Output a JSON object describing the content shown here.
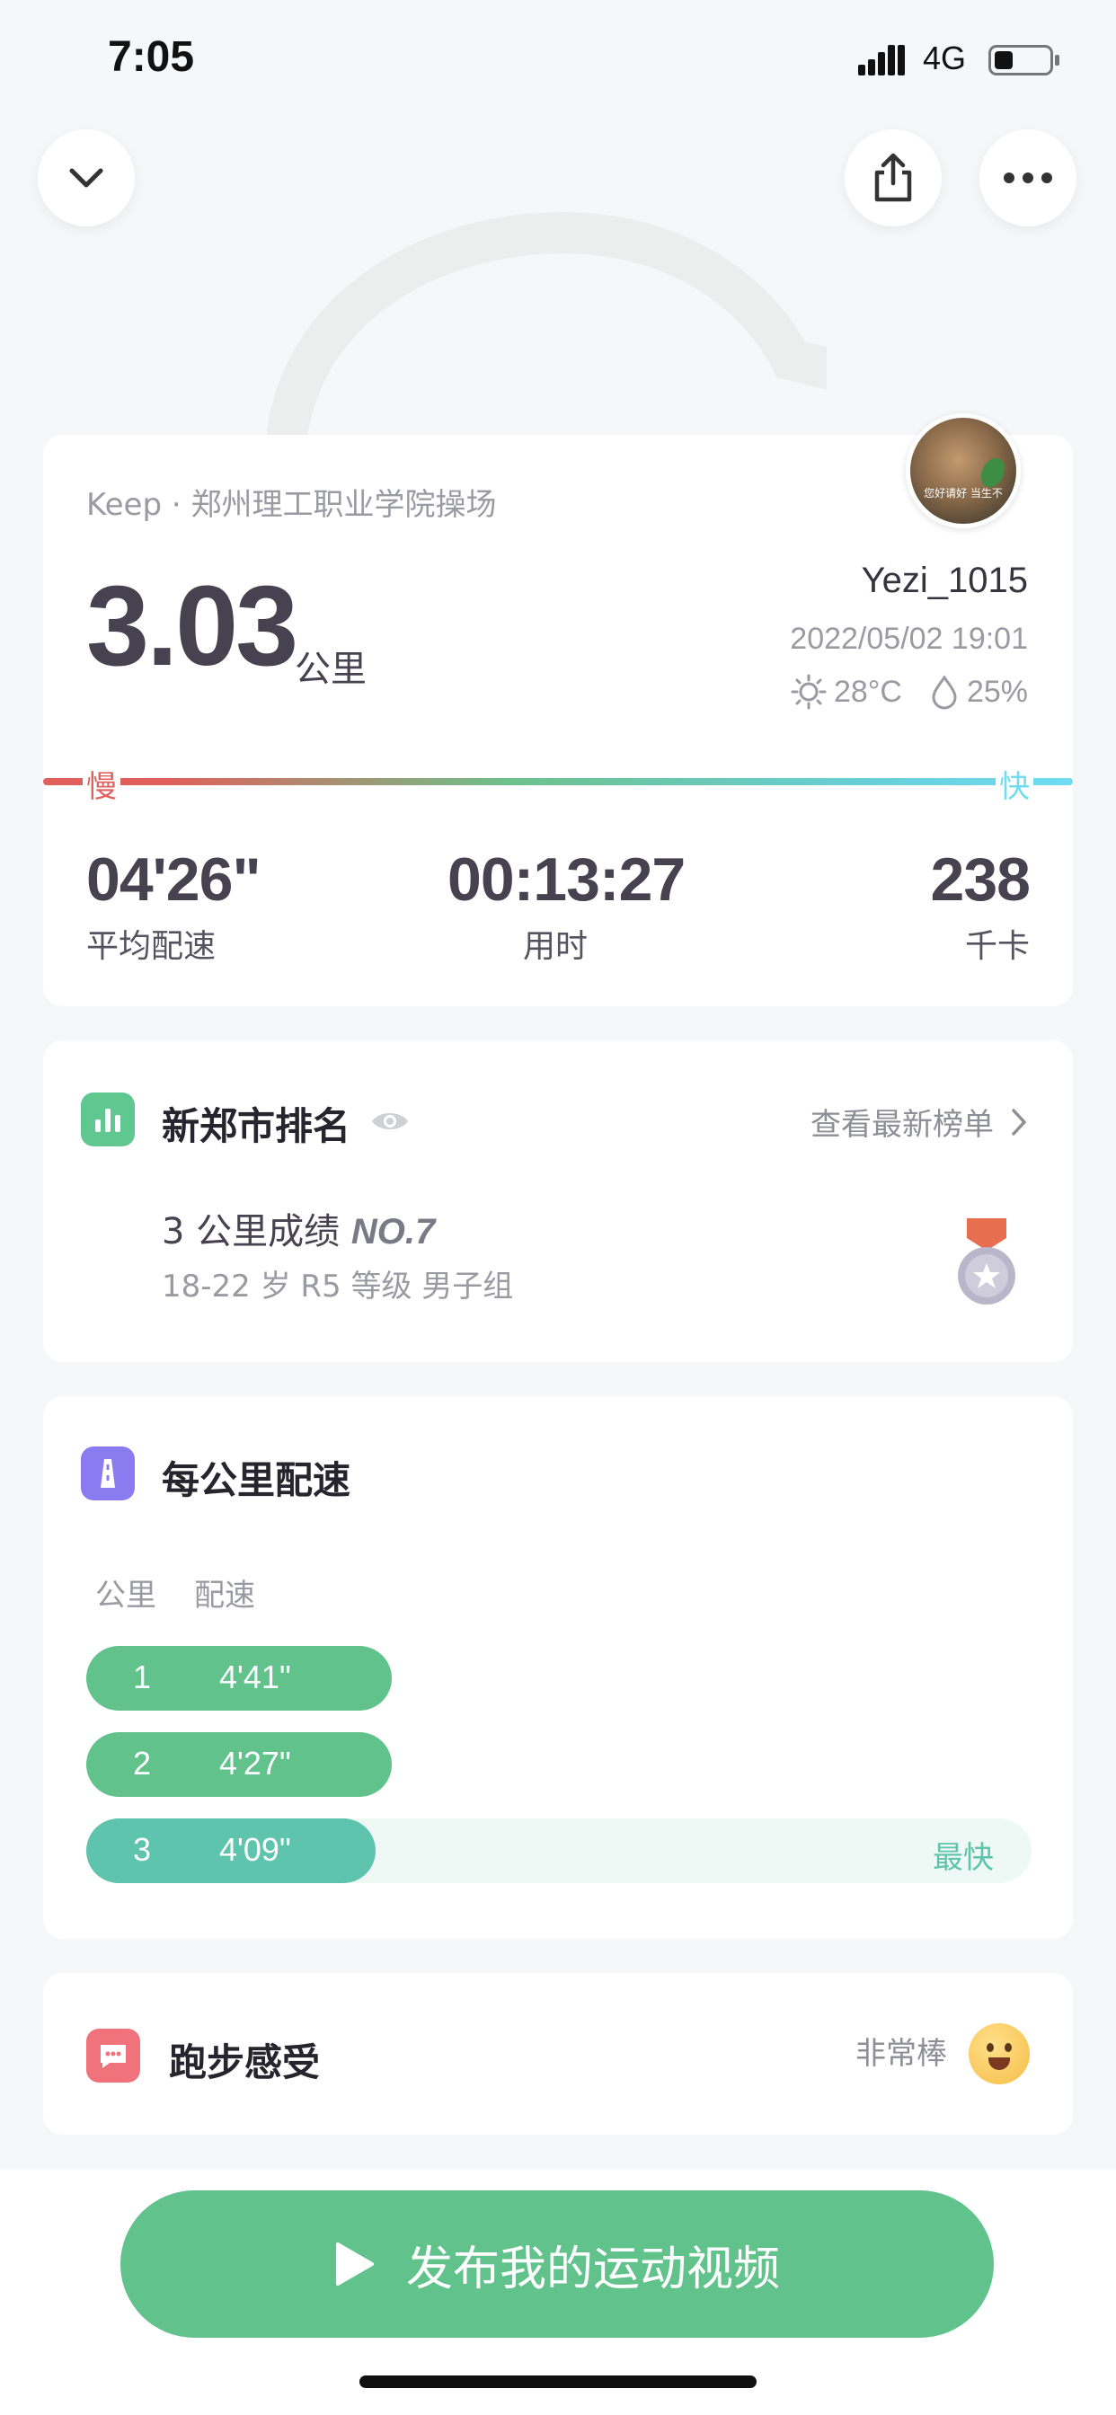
{
  "status_bar": {
    "time": "7:05",
    "network": "4G"
  },
  "summary": {
    "location": "Keep · 郑州理工职业学院操场",
    "distance": "3.03",
    "distance_unit": "公里",
    "username": "Yezi_1015",
    "datetime": "2022/05/02 19:01",
    "temperature": "28°C",
    "humidity": "25%",
    "avatar_caption": "您好请好 当生不",
    "slow_label": "慢",
    "fast_label": "快",
    "stats": [
      {
        "value": "04'26\"",
        "label": "平均配速"
      },
      {
        "value": "00:13:27",
        "label": "用时"
      },
      {
        "value": "238",
        "label": "千卡"
      }
    ]
  },
  "ranking": {
    "title": "新郑市排名",
    "link": "查看最新榜单",
    "record_prefix": "3 公里成绩",
    "record_no": "NO.7",
    "group": "18-22 岁 R5 等级 男子组"
  },
  "pace": {
    "title": "每公里配速",
    "col_km": "公里",
    "col_pace": "配速",
    "rows": [
      {
        "km": "1",
        "pace": "4'41\"",
        "fastest": false
      },
      {
        "km": "2",
        "pace": "4'27\"",
        "fastest": false
      },
      {
        "km": "3",
        "pace": "4'09\"",
        "fastest": true
      }
    ],
    "fastest_label": "最快"
  },
  "feeling": {
    "title": "跑步感受",
    "value": "非常棒"
  },
  "publish_button": "发布我的运动视频",
  "colors": {
    "accent_green": "#61c38b",
    "slow_red": "#e0615b",
    "fast_cyan": "#6fdcf2",
    "rank_icon": "#5fc78f",
    "pace_icon": "#8a7cf0",
    "feel_icon": "#f0727a"
  },
  "icons": {
    "collapse": "chevron-down-icon",
    "share": "share-icon",
    "more": "more-icon",
    "sun": "sun-icon",
    "drop": "drop-icon",
    "eye": "eye-icon",
    "medal": "medal-icon",
    "play": "play-icon"
  }
}
